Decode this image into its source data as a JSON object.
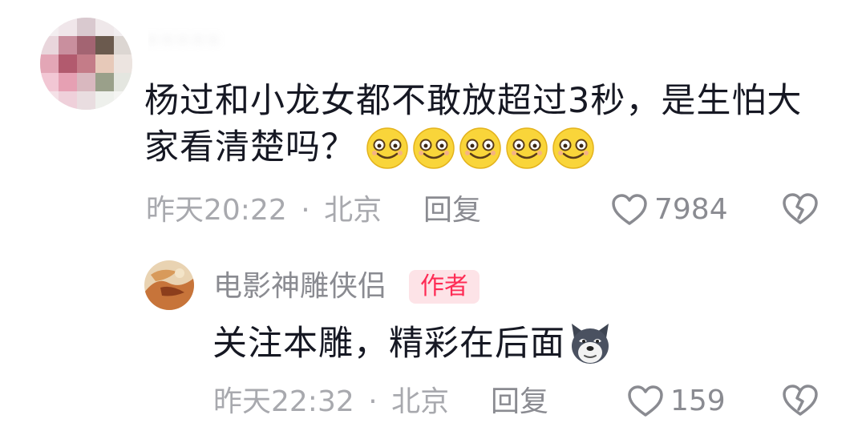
{
  "comment": {
    "username": "· · · · ·",
    "text": "杨过和小龙女都不敢放超过3秒，是生怕大家看清楚吗？",
    "emojis": [
      "smile-emoji",
      "smile-emoji",
      "smile-emoji",
      "smile-emoji",
      "smile-emoji"
    ],
    "time": "昨天20:22",
    "separator": "·",
    "location": "北京",
    "reply_label": "回复",
    "like_count": "7984"
  },
  "reply": {
    "username": "电影神雕侠侣",
    "badge": "作者",
    "text": "关注本雕，精彩在后面",
    "emoji": "doge-emoji",
    "time": "昨天22:32",
    "separator": "·",
    "location": "北京",
    "reply_label": "回复",
    "like_count": "159"
  },
  "colors": {
    "text": "#161823",
    "meta": "#a8a9ae",
    "secondary": "#8a8b91",
    "badge_bg": "#fde3e7",
    "badge_text": "#fe2c55"
  }
}
